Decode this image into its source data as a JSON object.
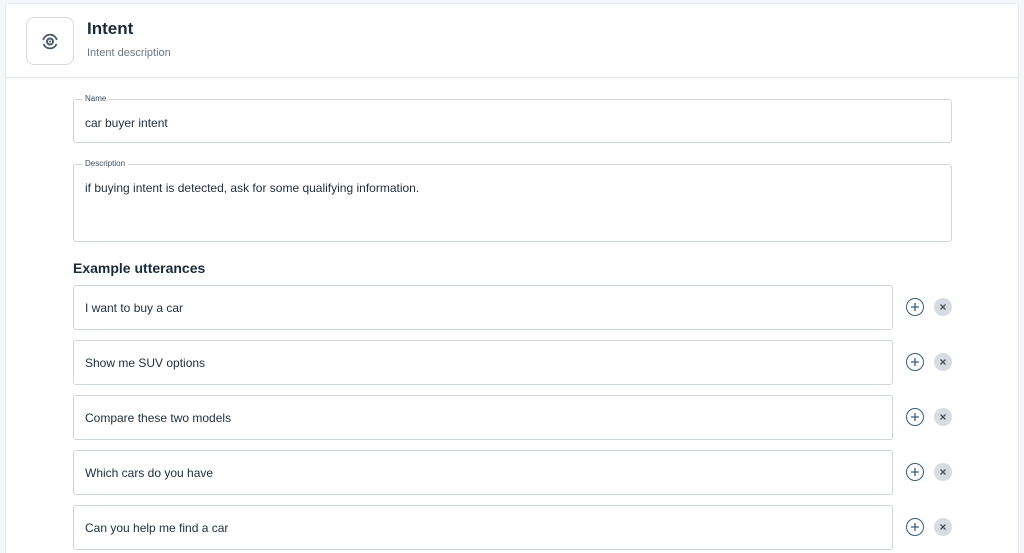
{
  "header": {
    "icon": "intent-target-icon",
    "title": "Intent",
    "subtitle": "Intent description"
  },
  "form": {
    "name": {
      "label": "Name",
      "value": "car buyer intent"
    },
    "description": {
      "label": "Description",
      "value": "if buying intent is detected, ask for some qualifying information."
    }
  },
  "utterances": {
    "title": "Example utterances",
    "items": [
      {
        "text": "I want to buy a car"
      },
      {
        "text": "Show me SUV options"
      },
      {
        "text": "Compare these two models"
      },
      {
        "text": "Which cars do you have"
      },
      {
        "text": "Can you help me find a car"
      }
    ],
    "add_icon": "plus-circle-icon",
    "remove_icon": "close-circle-icon"
  },
  "colors": {
    "accent": "#3a5d7c",
    "border": "#cfd5dd",
    "remove_bg": "#d7dce3"
  }
}
